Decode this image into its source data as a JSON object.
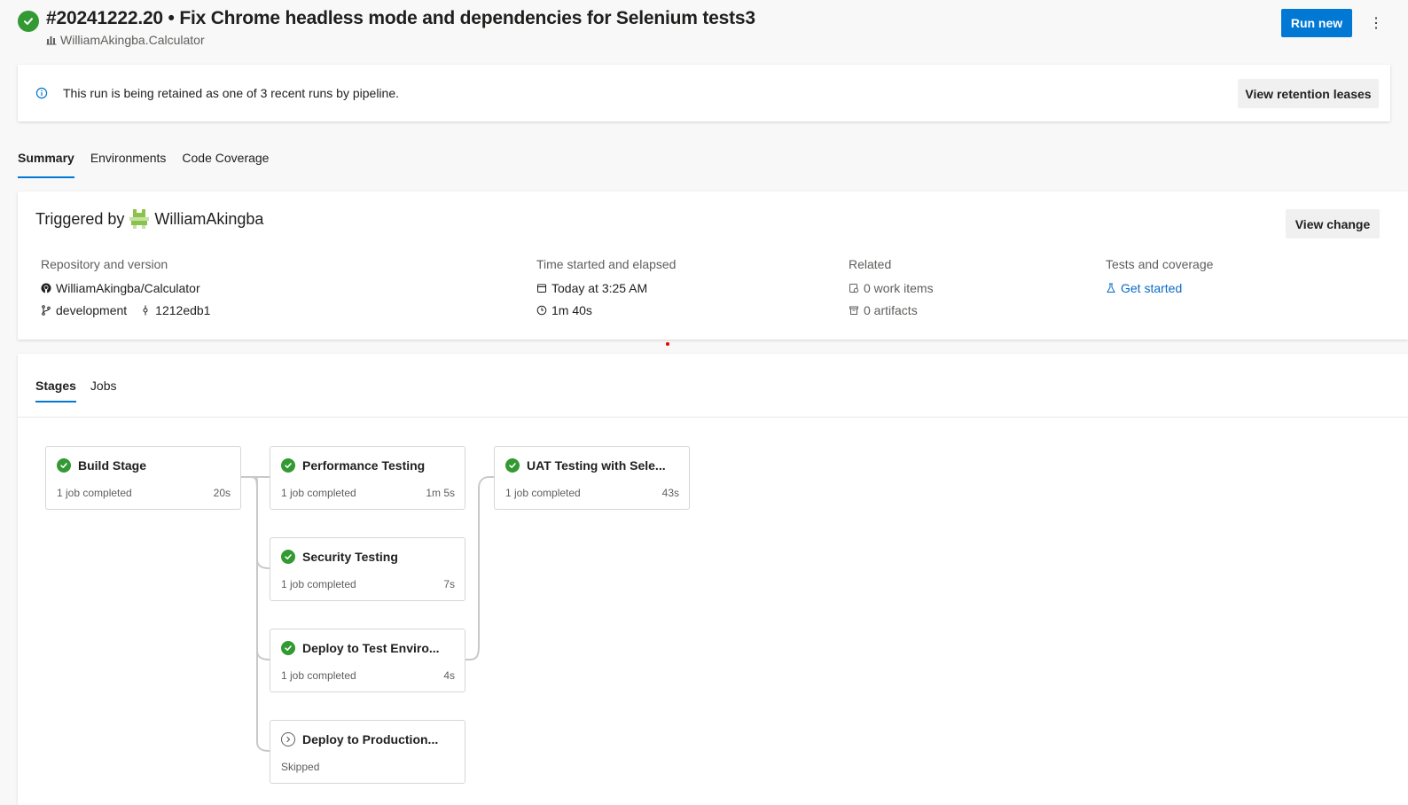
{
  "header": {
    "title": "#20241222.20 • Fix Chrome headless mode and dependencies for Selenium tests3",
    "repo": "WilliamAkingba.Calculator",
    "run_new_label": "Run new",
    "more_label": "⋮",
    "status": "succeeded"
  },
  "banner": {
    "text": "This run is being retained as one of 3 recent runs by pipeline.",
    "button_label": "View retention leases"
  },
  "tabs": [
    {
      "label": "Summary",
      "active": true
    },
    {
      "label": "Environments",
      "active": false
    },
    {
      "label": "Code Coverage",
      "active": false
    }
  ],
  "summary": {
    "triggered_prefix": "Triggered by",
    "triggered_user": "WilliamAkingba",
    "view_change_label": "View change",
    "repository": {
      "label": "Repository and version",
      "repo": "WilliamAkingba/Calculator",
      "branch": "development",
      "commit": "1212edb1"
    },
    "time": {
      "label": "Time started and elapsed",
      "started": "Today at 3:25 AM",
      "elapsed": "1m 40s"
    },
    "related": {
      "label": "Related",
      "work_items": "0 work items",
      "artifacts": "0 artifacts"
    },
    "tests": {
      "label": "Tests and coverage",
      "link": "Get started"
    }
  },
  "stages_panel": {
    "tabs": [
      {
        "label": "Stages",
        "active": true
      },
      {
        "label": "Jobs",
        "active": false
      }
    ],
    "stages": [
      {
        "name": "Build Stage",
        "status": "1 job completed",
        "duration": "20s",
        "state": "succeeded"
      },
      {
        "name": "Performance Testing",
        "status": "1 job completed",
        "duration": "1m 5s",
        "state": "succeeded"
      },
      {
        "name": "Security Testing",
        "status": "1 job completed",
        "duration": "7s",
        "state": "succeeded"
      },
      {
        "name": "Deploy to Test Enviro...",
        "status": "1 job completed",
        "duration": "4s",
        "state": "succeeded"
      },
      {
        "name": "Deploy to Production...",
        "status": "Skipped",
        "duration": "",
        "state": "skipped"
      },
      {
        "name": "UAT Testing with Sele...",
        "status": "1 job completed",
        "duration": "43s",
        "state": "succeeded"
      }
    ]
  },
  "colors": {
    "accent": "#0078d4",
    "success": "#339933",
    "link": "#0b6bc4"
  }
}
